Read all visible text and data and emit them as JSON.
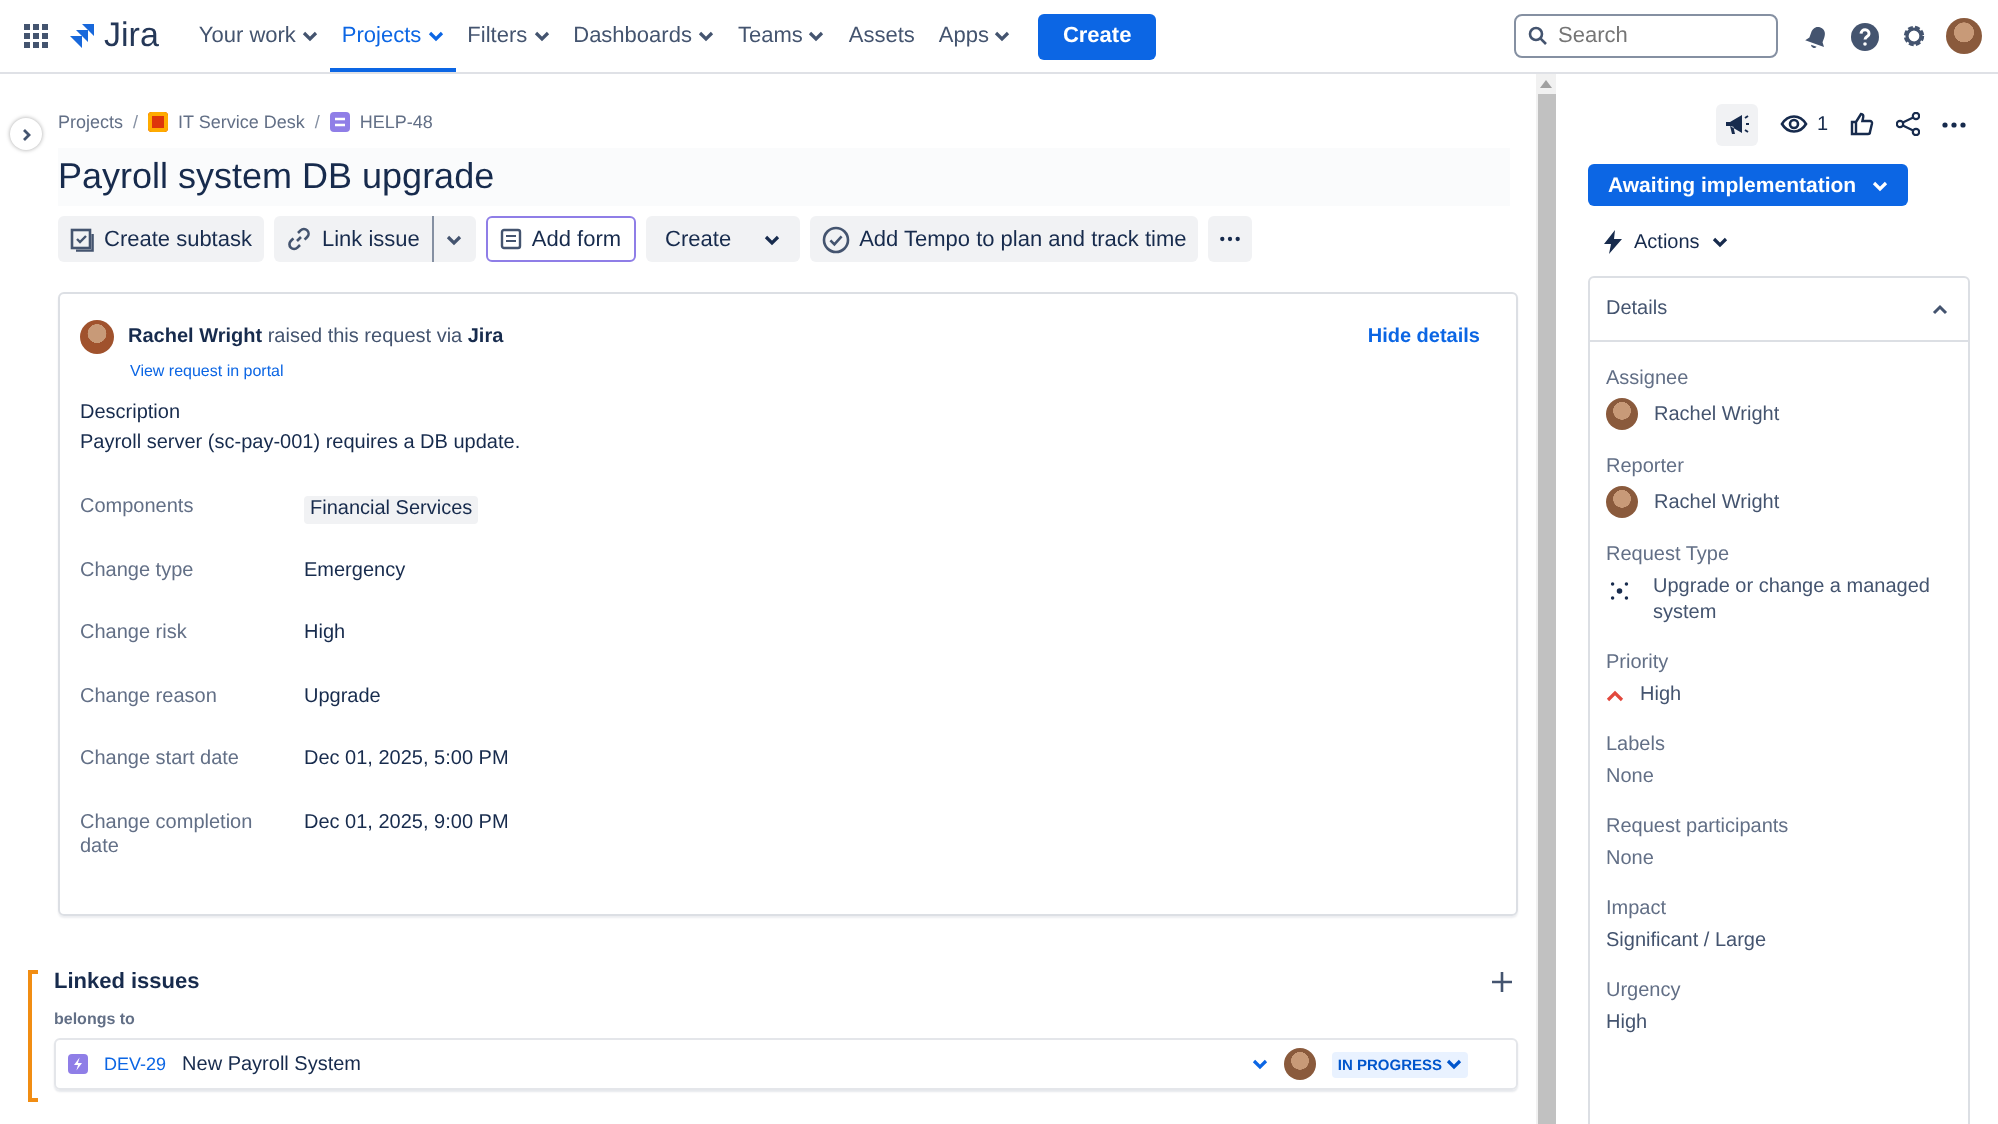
{
  "nav": {
    "logo": "Jira",
    "items": [
      {
        "label": "Your work",
        "selected": false,
        "menu": true
      },
      {
        "label": "Projects",
        "selected": true,
        "menu": true
      },
      {
        "label": "Filters",
        "selected": false,
        "menu": true
      },
      {
        "label": "Dashboards",
        "selected": false,
        "menu": true
      },
      {
        "label": "Teams",
        "selected": false,
        "menu": true
      },
      {
        "label": "Assets",
        "selected": false,
        "menu": false
      },
      {
        "label": "Apps",
        "selected": false,
        "menu": true
      }
    ],
    "create": "Create",
    "search": {
      "placeholder": "Search"
    }
  },
  "breadcrumbs": [
    {
      "label": "Projects",
      "kind": "plain"
    },
    {
      "label": "/",
      "kind": "separator"
    },
    {
      "label": "IT Service Desk",
      "kind": "project"
    },
    {
      "label": "/",
      "kind": "separator"
    },
    {
      "label": "HELP-48",
      "kind": "issue"
    }
  ],
  "title": "Payroll system DB upgrade",
  "toolbar": [
    {
      "kind": "subtask",
      "label": "Create subtask",
      "selected": false
    },
    {
      "kind": "link",
      "label": "Link issue",
      "selected": false
    },
    {
      "kind": "form",
      "label": "Add form",
      "selected": true
    },
    {
      "kind": "dropdown",
      "label": "Create",
      "selected": false
    },
    {
      "kind": "tempo",
      "label": "Add Tempo to plan and track time",
      "selected": false
    },
    {
      "kind": "more",
      "selected": false
    }
  ],
  "request": {
    "raised": "**Rachel Wright** raised this request via **Jira**",
    "portal_link": "View request in portal",
    "hide": "Hide details",
    "description_label": "Description",
    "description": "Payroll server (sc-pay-001) requires a DB update.",
    "fields": [
      {
        "label": "Components",
        "value": "Financial Services",
        "kind": "tag"
      },
      {
        "label": "Change type",
        "value": "Emergency",
        "kind": "text"
      },
      {
        "label": "Change risk",
        "value": "High",
        "kind": "text"
      },
      {
        "label": "Change reason",
        "value": "Upgrade",
        "kind": "text"
      },
      {
        "label": "Change start date",
        "value": "Dec 01, 2025, 5:00 PM",
        "kind": "text"
      },
      {
        "label": "Change completion date",
        "value": "Dec 01, 2025, 9:00 PM",
        "kind": "text"
      }
    ]
  },
  "linked": {
    "title": "Linked issues",
    "group": "belongs to",
    "issues": [
      {
        "key": "DEV-29",
        "summary": "New Payroll System",
        "status": "IN PROGRESS"
      }
    ]
  },
  "side": {
    "watchers": "1",
    "status": "Awaiting implementation",
    "actions": "Actions",
    "details": {
      "title": "Details",
      "expanded": true,
      "fields": [
        {
          "label": "Assignee",
          "value": "Rachel Wright",
          "kind": "user"
        },
        {
          "label": "Reporter",
          "value": "Rachel Wright",
          "kind": "user"
        },
        {
          "label": "Request Type",
          "value": "Upgrade or change a managed system",
          "kind": "request-type"
        },
        {
          "label": "Priority",
          "value": "High",
          "kind": "priority"
        },
        {
          "label": "Labels",
          "value": "None",
          "kind": "empty"
        },
        {
          "label": "Request participants",
          "value": "None",
          "kind": "empty"
        },
        {
          "label": "Impact",
          "value": "Significant / Large",
          "kind": "text"
        },
        {
          "label": "Urgency",
          "value": "High",
          "kind": "text"
        }
      ]
    }
  }
}
